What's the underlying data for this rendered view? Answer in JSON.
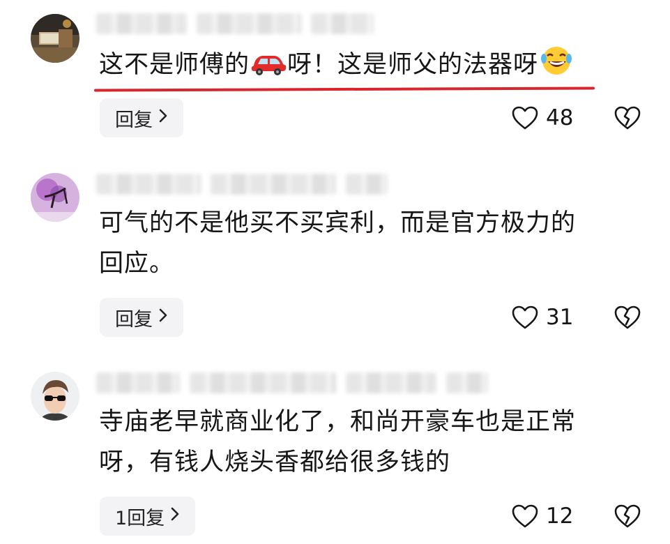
{
  "comments": [
    {
      "text_a": "这不是师傅的",
      "emoji_car": "car-emoji",
      "text_b": "呀！这是师父的法器呀",
      "emoji_laugh": "rolling-laughing-emoji",
      "reply_label": "回复",
      "likes": "48"
    },
    {
      "text_line1": "可气的不是他买不买宾利，而是官方极力的",
      "text_line2": "回应。",
      "reply_label": "回复",
      "likes": "31"
    },
    {
      "text_line1": "寺庙老早就商业化了，和尚开豪车也是正常",
      "text_line2": "呀，有钱人烧头香都给很多钱的",
      "reply_label": "1回复",
      "likes": "12"
    }
  ],
  "icons": {
    "like": "heart-outline-icon",
    "dislike": "broken-heart-icon",
    "chevron": "chevron-right-icon"
  },
  "colors": {
    "underline": "#d8262c",
    "button_bg": "#f3f3f5"
  }
}
